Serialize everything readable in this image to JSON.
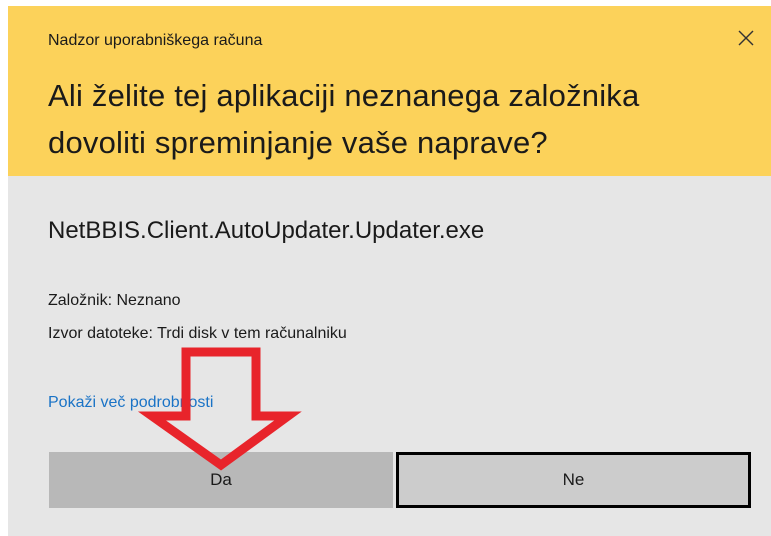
{
  "dialog": {
    "window_title": "Nadzor uporabniškega računa",
    "question": "Ali želite tej aplikaciji neznanega založnika dovoliti spreminjanje vaše naprave?",
    "app_name": "NetBBIS.Client.AutoUpdater.Updater.exe",
    "publisher_line": "Založnik: Neznano",
    "origin_line": "Izvor datoteke: Trdi disk v tem računalniku",
    "details_link": "Pokaži več podrobnosti",
    "yes_label": "Da",
    "no_label": "Ne",
    "close_icon": "close-icon"
  },
  "colors": {
    "header_bg": "#fcd25a",
    "body_bg": "#e6e6e6",
    "link": "#1a73c6",
    "annotation_arrow": "#e8242b"
  }
}
